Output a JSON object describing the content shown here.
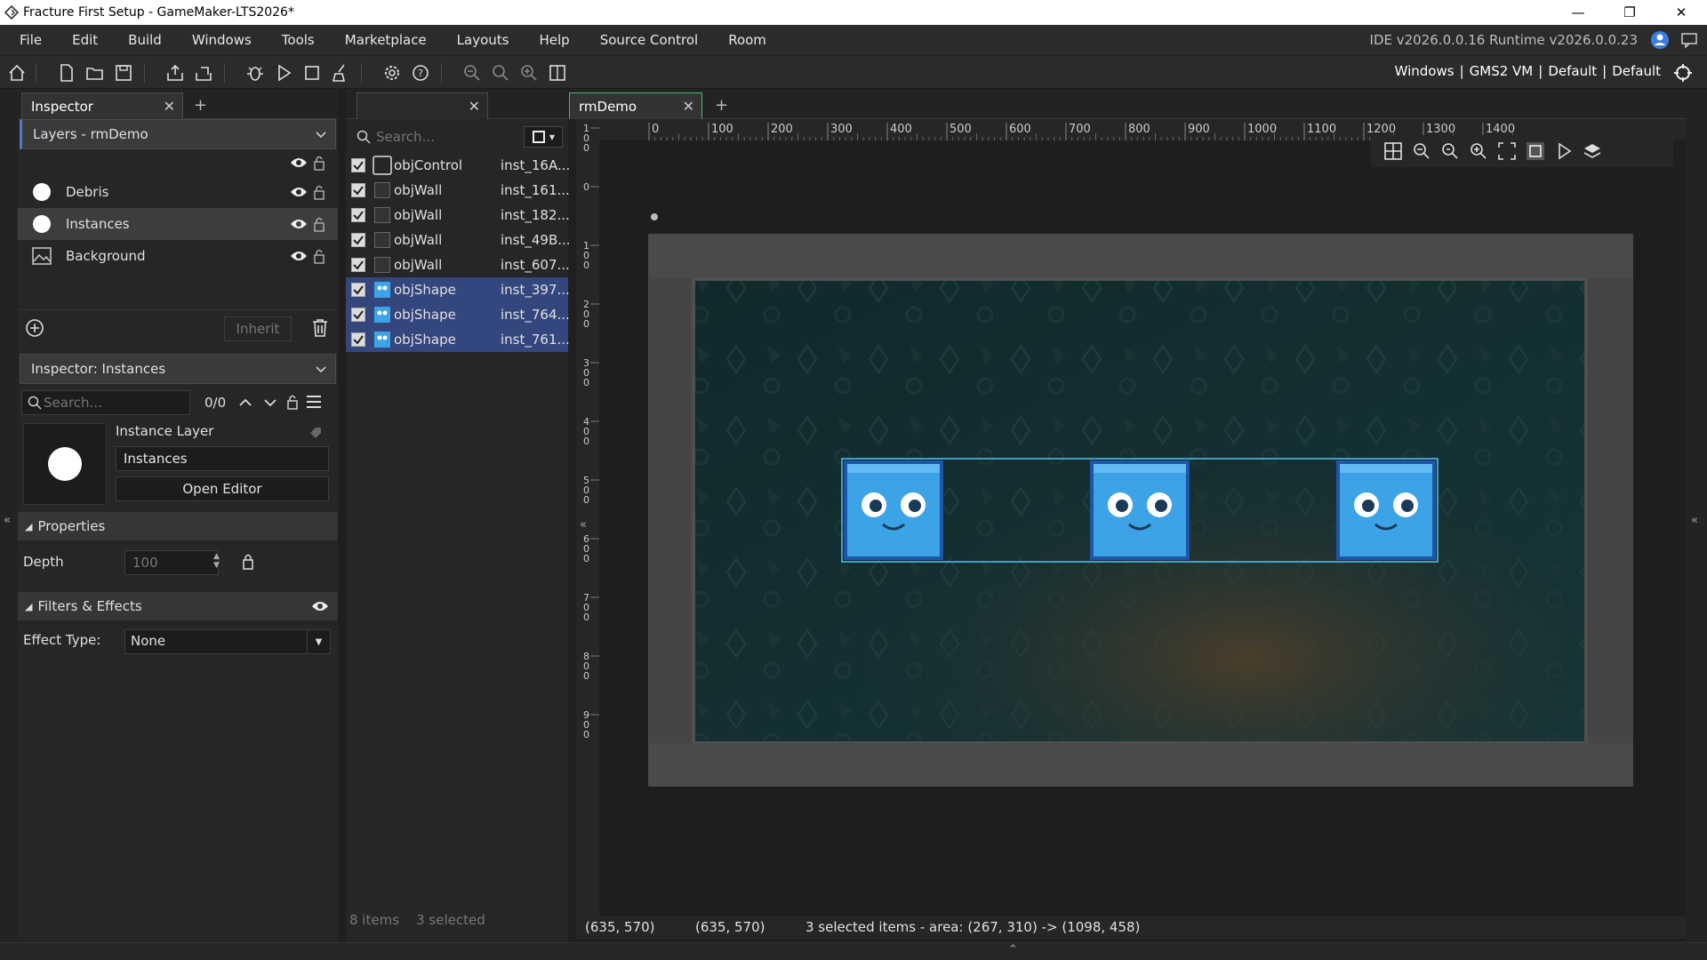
{
  "window": {
    "title": "Fracture First Setup - GameMaker-LTS2026*"
  },
  "menu": [
    "File",
    "Edit",
    "Build",
    "Windows",
    "Tools",
    "Marketplace",
    "Layouts",
    "Help",
    "Source Control",
    "Room"
  ],
  "version": "IDE v2026.0.0.16  Runtime v2026.0.0.23",
  "target": {
    "platform": "Windows",
    "vm": "GMS2 VM",
    "config1": "Default",
    "config2": "Default"
  },
  "left": {
    "tab": "Inspector",
    "layers_title": "Layers - rmDemo",
    "layers": [
      {
        "name": "Debris",
        "icon": "circle-icon"
      },
      {
        "name": "Instances",
        "icon": "circle-icon",
        "selected": true
      },
      {
        "name": "Background",
        "icon": "image-icon"
      }
    ],
    "inherit_label": "Inherit",
    "inspector_title": "Inspector: Instances",
    "search_placeholder": "Search...",
    "search_count": "0/0",
    "instance_layer_label": "Instance Layer",
    "instance_layer_name": "Instances",
    "open_editor": "Open Editor",
    "properties_label": "Properties",
    "depth_label": "Depth",
    "depth_value": "100",
    "filters_label": "Filters & Effects",
    "effect_label": "Effect Type:",
    "effect_value": "None"
  },
  "middle": {
    "search_placeholder": "Search...",
    "instances": [
      {
        "obj": "objControl",
        "id": "inst_16A...",
        "selected": false,
        "icon": "blank"
      },
      {
        "obj": "objWall",
        "id": "inst_161...",
        "selected": false,
        "icon": "wall"
      },
      {
        "obj": "objWall",
        "id": "inst_182...",
        "selected": false,
        "icon": "wall"
      },
      {
        "obj": "objWall",
        "id": "inst_49B...",
        "selected": false,
        "icon": "wall"
      },
      {
        "obj": "objWall",
        "id": "inst_607...",
        "selected": false,
        "icon": "wall"
      },
      {
        "obj": "objShape",
        "id": "inst_397...",
        "selected": true,
        "icon": "shape"
      },
      {
        "obj": "objShape",
        "id": "inst_764...",
        "selected": true,
        "icon": "shape"
      },
      {
        "obj": "objShape",
        "id": "inst_761...",
        "selected": true,
        "icon": "shape"
      }
    ],
    "footer_items": "8 items",
    "footer_selected": "3 selected"
  },
  "room": {
    "tab": "rmDemo",
    "ruler_h": [
      "0",
      "100",
      "200",
      "300",
      "400",
      "500",
      "600",
      "700",
      "800",
      "900",
      "1000",
      "1100",
      "1200",
      "1300",
      "1400"
    ],
    "ruler_v": [
      "1\n0\n0",
      "0",
      "1\n0\n0",
      "2\n0\n0",
      "3\n0\n0",
      "4\n0\n0",
      "5\n0\n0",
      "6\n0\n0",
      "7\n0\n0",
      "8\n0\n0",
      "9\n0\n0"
    ],
    "coord1": "(635, 570)",
    "coord2": "(635, 570)",
    "selection_info": "3 selected items - area: (267, 310) -> (1098, 458)"
  },
  "colors": {
    "accent": "#34467e",
    "shape": "#3ba3e6",
    "selection": "#4fc3f7"
  }
}
